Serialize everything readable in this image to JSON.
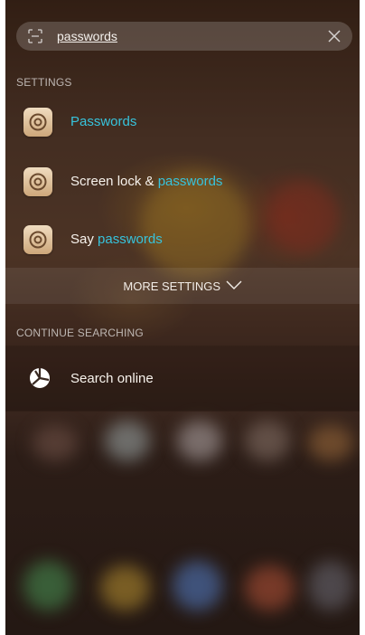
{
  "search": {
    "query": "passwords",
    "scan_icon": "scan-icon",
    "clear_icon": "close-icon"
  },
  "settings_section": {
    "header": "SETTINGS",
    "results": [
      {
        "pre": "",
        "match": "Passwords",
        "post": "",
        "icon": "settings-gear-icon"
      },
      {
        "pre": "Screen lock & ",
        "match": "passwords",
        "post": "",
        "icon": "settings-gear-icon"
      },
      {
        "pre": "Say ",
        "match": "passwords",
        "post": "",
        "icon": "settings-gear-icon"
      }
    ],
    "more_label": "MORE SETTINGS",
    "more_icon": "chevron-down-icon"
  },
  "continue_section": {
    "header": "CONTINUE SEARCHING",
    "search_online_label": "Search online",
    "search_online_icon": "globe-icon"
  },
  "colors": {
    "highlight": "#37c3dc",
    "text": "#f7f2ec"
  }
}
